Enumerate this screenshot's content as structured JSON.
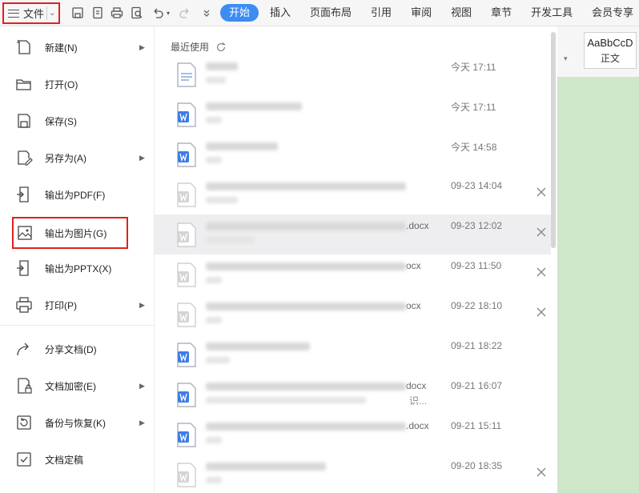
{
  "toolbar": {
    "file_label": "文件",
    "tabs": [
      "开始",
      "插入",
      "页面布局",
      "引用",
      "审阅",
      "视图",
      "章节",
      "开发工具",
      "会员专享"
    ],
    "active_tab": "开始"
  },
  "ribbon": {
    "style_sample": "AaBbCcD",
    "style_name": "正文"
  },
  "file_menu": {
    "items": [
      {
        "label": "新建(N)",
        "icon": "new-doc-icon",
        "submenu": true
      },
      {
        "label": "打开(O)",
        "icon": "folder-open-icon",
        "submenu": false
      },
      {
        "label": "保存(S)",
        "icon": "save-icon",
        "submenu": false
      },
      {
        "label": "另存为(A)",
        "icon": "save-as-icon",
        "submenu": true
      },
      {
        "label": "输出为PDF(F)",
        "icon": "export-pdf-icon",
        "submenu": false
      },
      {
        "label": "输出为图片(G)",
        "icon": "export-image-icon",
        "submenu": false,
        "highlighted": true
      },
      {
        "label": "输出为PPTX(X)",
        "icon": "export-pptx-icon",
        "submenu": false
      },
      {
        "label": "打印(P)",
        "icon": "print-icon",
        "submenu": true
      },
      {
        "label": "分享文档(D)",
        "icon": "share-icon",
        "submenu": false
      },
      {
        "label": "文档加密(E)",
        "icon": "encrypt-icon",
        "submenu": true
      },
      {
        "label": "备份与恢复(K)",
        "icon": "backup-icon",
        "submenu": true
      },
      {
        "label": "文档定稿",
        "icon": "finalize-icon",
        "submenu": false
      }
    ]
  },
  "recent": {
    "header": "最近使用",
    "files": [
      {
        "name_suffix": "",
        "time": "今天  17:11",
        "type": "text",
        "closable": false
      },
      {
        "name_suffix": "",
        "time": "今天  17:11",
        "type": "word",
        "closable": false
      },
      {
        "name_suffix": "",
        "time": "今天  14:58",
        "type": "word",
        "closable": false
      },
      {
        "name_suffix": "",
        "time": "09-23 14:04",
        "type": "word-gray",
        "closable": true
      },
      {
        "name_suffix": ".docx",
        "time": "09-23 12:02",
        "type": "word-gray",
        "closable": true,
        "hovered": true
      },
      {
        "name_suffix": "ocx",
        "time": "09-23 11:50",
        "type": "word-gray",
        "closable": true
      },
      {
        "name_suffix": "ocx",
        "time": "09-22 18:10",
        "type": "word-gray",
        "closable": true
      },
      {
        "name_suffix": "",
        "time": "09-21 18:22",
        "type": "word",
        "closable": false
      },
      {
        "name_suffix": "docx",
        "time": "09-21 16:07",
        "type": "word",
        "closable": false,
        "path_suffix": "识..."
      },
      {
        "name_suffix": ".docx",
        "time": "09-21 15:11",
        "type": "word",
        "closable": false
      },
      {
        "name_suffix": "",
        "time": "09-20 18:35",
        "type": "word-gray",
        "closable": true
      }
    ]
  }
}
